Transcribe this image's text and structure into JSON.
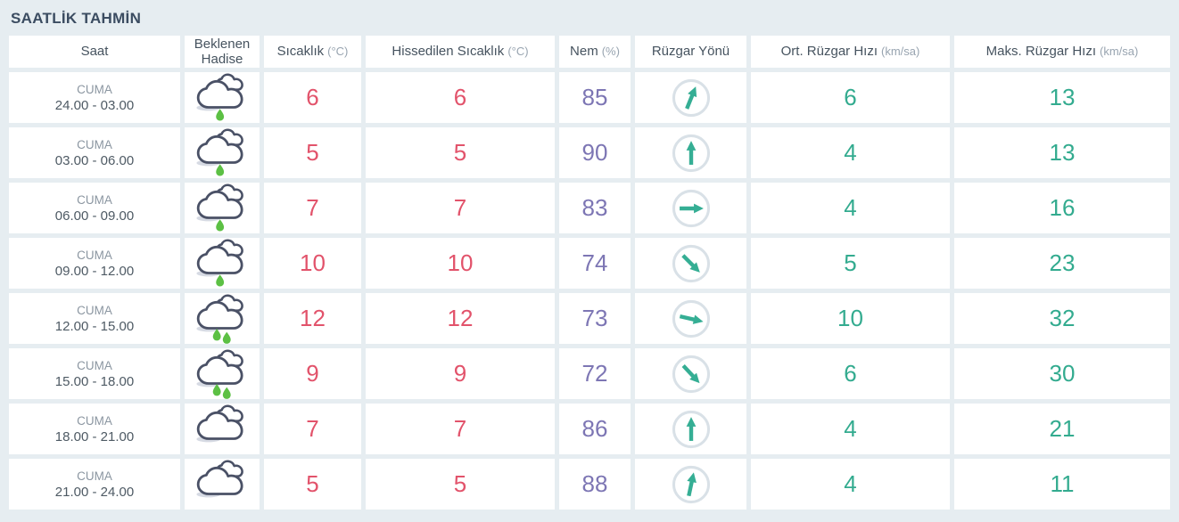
{
  "title": "SAATLİK TAHMİN",
  "colors": {
    "background": "#e6edf1",
    "cell_background": "#ffffff",
    "title_text": "#3b4c61",
    "header_text": "#46535f",
    "header_unit_text": "#98a4b0",
    "temperature": "#e2536b",
    "humidity": "#7d76b4",
    "wind": "#33ab8f",
    "rain_drop": "#5cc044",
    "cloud_outline": "#4a5166",
    "wind_circle": "#d9e1e7"
  },
  "table": {
    "headers": [
      {
        "label": "Saat",
        "unit": ""
      },
      {
        "label": "Beklenen Hadise",
        "unit": ""
      },
      {
        "label": "Sıcaklık",
        "unit": "(°C)"
      },
      {
        "label": "Hissedilen Sıcaklık",
        "unit": "(°C)"
      },
      {
        "label": "Nem",
        "unit": "(%)"
      },
      {
        "label": "Rüzgar Yönü",
        "unit": ""
      },
      {
        "label": "Ort. Rüzgar Hızı",
        "unit": "(km/sa)"
      },
      {
        "label": "Maks. Rüzgar Hızı",
        "unit": "(km/sa)"
      }
    ],
    "rows": [
      {
        "day": "CUMA",
        "time": "24.00 - 03.00",
        "weather_icon": "cloud-light-rain",
        "temperature": "6",
        "feels_like": "6",
        "humidity": "85",
        "wind_direction_deg": 22,
        "wind_avg": "6",
        "wind_max": "13"
      },
      {
        "day": "CUMA",
        "time": "03.00 - 06.00",
        "weather_icon": "cloud-light-rain",
        "temperature": "5",
        "feels_like": "5",
        "humidity": "90",
        "wind_direction_deg": 0,
        "wind_avg": "4",
        "wind_max": "13"
      },
      {
        "day": "CUMA",
        "time": "06.00 - 09.00",
        "weather_icon": "cloud-light-rain",
        "temperature": "7",
        "feels_like": "7",
        "humidity": "83",
        "wind_direction_deg": 90,
        "wind_avg": "4",
        "wind_max": "16"
      },
      {
        "day": "CUMA",
        "time": "09.00 - 12.00",
        "weather_icon": "cloud-light-rain",
        "temperature": "10",
        "feels_like": "10",
        "humidity": "74",
        "wind_direction_deg": 135,
        "wind_avg": "5",
        "wind_max": "23"
      },
      {
        "day": "CUMA",
        "time": "12.00 - 15.00",
        "weather_icon": "cloud-rain",
        "temperature": "12",
        "feels_like": "12",
        "humidity": "73",
        "wind_direction_deg": 103,
        "wind_avg": "10",
        "wind_max": "32"
      },
      {
        "day": "CUMA",
        "time": "15.00 - 18.00",
        "weather_icon": "cloud-rain",
        "temperature": "9",
        "feels_like": "9",
        "humidity": "72",
        "wind_direction_deg": 137,
        "wind_avg": "6",
        "wind_max": "30"
      },
      {
        "day": "CUMA",
        "time": "18.00 - 21.00",
        "weather_icon": "cloudy",
        "temperature": "7",
        "feels_like": "7",
        "humidity": "86",
        "wind_direction_deg": 0,
        "wind_avg": "4",
        "wind_max": "21"
      },
      {
        "day": "CUMA",
        "time": "21.00 - 24.00",
        "weather_icon": "cloudy",
        "temperature": "5",
        "feels_like": "5",
        "humidity": "88",
        "wind_direction_deg": 12,
        "wind_avg": "4",
        "wind_max": "11"
      }
    ]
  }
}
